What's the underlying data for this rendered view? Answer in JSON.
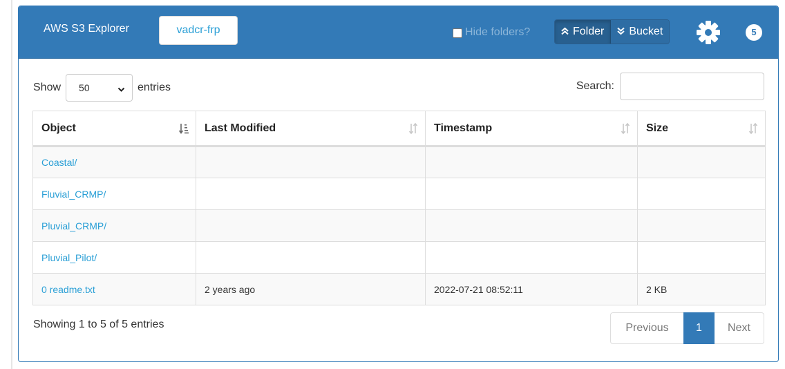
{
  "header": {
    "app_title": "AWS S3 Explorer",
    "bucket_label": "vadcr-frp",
    "hide_folders_label": "Hide folders?",
    "hide_folders_checked": false,
    "folder_button": "Folder",
    "bucket_button": "Bucket",
    "settings_icon": "gear-icon",
    "badge_count": "5"
  },
  "controls": {
    "show_label": "Show",
    "page_length": "50",
    "entries_label": "entries",
    "search_label": "Search:",
    "search_value": ""
  },
  "table": {
    "columns": [
      "Object",
      "Last Modified",
      "Timestamp",
      "Size"
    ],
    "rows": [
      {
        "object": "Coastal/",
        "last_modified": "",
        "timestamp": "",
        "size": ""
      },
      {
        "object": "Fluvial_CRMP/",
        "last_modified": "",
        "timestamp": "",
        "size": ""
      },
      {
        "object": "Pluvial_CRMP/",
        "last_modified": "",
        "timestamp": "",
        "size": ""
      },
      {
        "object": "Pluvial_Pilot/",
        "last_modified": "",
        "timestamp": "",
        "size": ""
      },
      {
        "object": "0 readme.txt",
        "last_modified": "2 years ago",
        "timestamp": "2022-07-21 08:52:11",
        "size": "2 KB"
      }
    ]
  },
  "footer": {
    "info": "Showing 1 to 5 of 5 entries",
    "previous": "Previous",
    "current_page": "1",
    "next": "Next"
  },
  "colors": {
    "primary": "#337ab7",
    "link": "#2a9fd6",
    "border": "#dddddd"
  }
}
